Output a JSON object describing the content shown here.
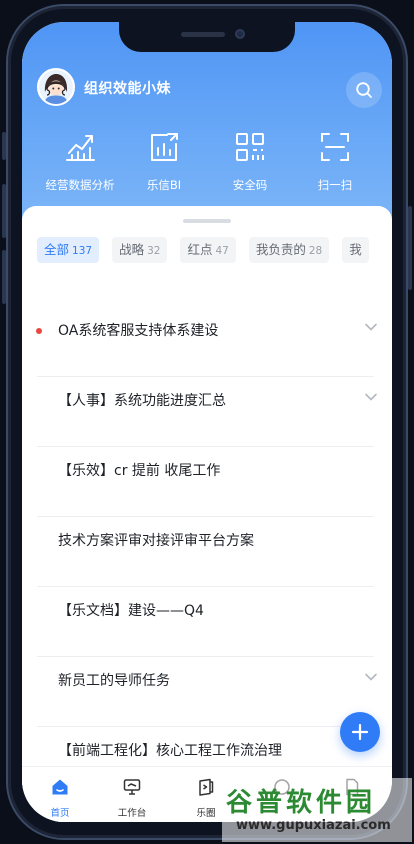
{
  "user": {
    "name": "组织效能小妹"
  },
  "quick_actions": [
    {
      "label": "经营数据分析",
      "icon": "line-chart-icon"
    },
    {
      "label": "乐信BI",
      "icon": "bar-chart-icon"
    },
    {
      "label": "安全码",
      "icon": "qr-code-icon"
    },
    {
      "label": "扫一扫",
      "icon": "scan-icon"
    }
  ],
  "filters": [
    {
      "label": "全部",
      "count": "137",
      "active": true
    },
    {
      "label": "战略",
      "count": "32"
    },
    {
      "label": "红点",
      "count": "47"
    },
    {
      "label": "我负责的",
      "count": "28"
    },
    {
      "label": "我"
    }
  ],
  "tasks": [
    {
      "title": "OA系统客服支持体系建设",
      "red_dot": true,
      "expandable": true
    },
    {
      "title": "【人事】系统功能进度汇总",
      "expandable": true
    },
    {
      "title": "【乐效】cr 提前 收尾工作"
    },
    {
      "title": "技术方案评审对接评审平台方案"
    },
    {
      "title": "【乐文档】建设——Q4"
    },
    {
      "title": "新员工的导师任务",
      "expandable": true
    },
    {
      "title": "【前端工程化】核心工程工作流治理"
    }
  ],
  "tabbar": [
    {
      "label": "首页",
      "icon": "home-icon",
      "active": true
    },
    {
      "label": "工作台",
      "icon": "workbench-icon"
    },
    {
      "label": "乐圈",
      "icon": "circle-icon"
    }
  ],
  "watermark": {
    "main": "谷普软件园",
    "url": "www.gupuxiazai.com"
  },
  "colors": {
    "primary": "#2f7cf6",
    "header_top": "#4f95f5",
    "red_dot": "#e9473f"
  }
}
